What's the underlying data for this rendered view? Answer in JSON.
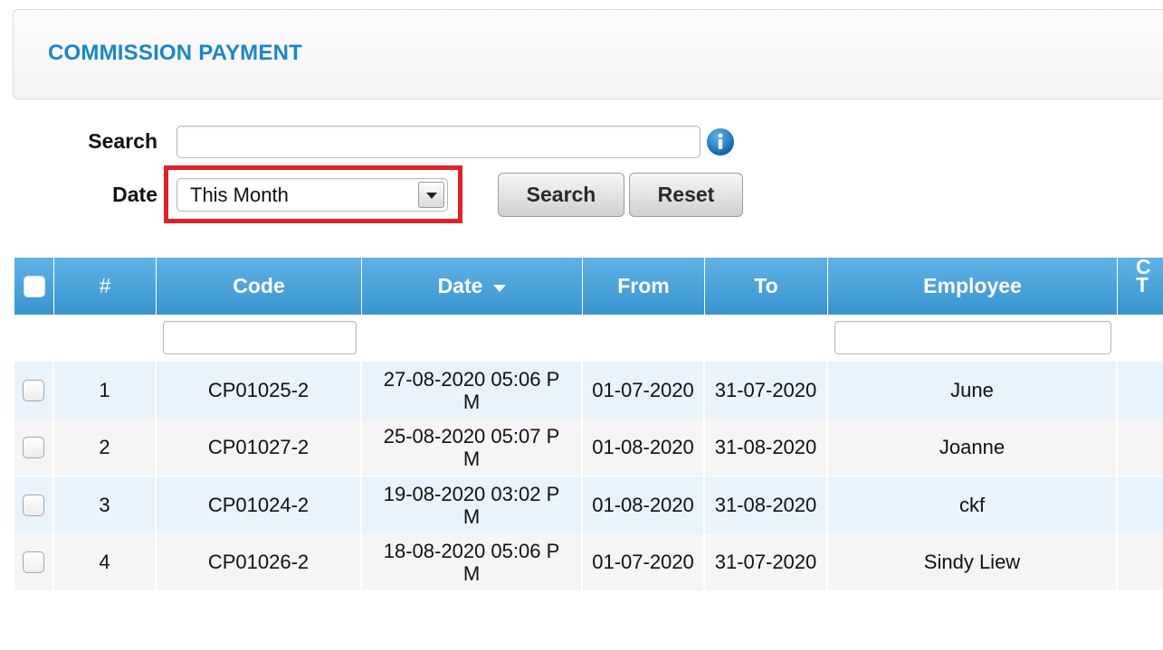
{
  "page": {
    "title": "COMMISSION PAYMENT"
  },
  "filters": {
    "search_label": "Search",
    "search_value": "",
    "search_placeholder": "",
    "date_label": "Date",
    "date_selected": "This Month",
    "search_button": "Search",
    "reset_button": "Reset"
  },
  "table": {
    "columns": {
      "hash": "#",
      "code": "Code",
      "date": "Date",
      "from": "From",
      "to": "To",
      "employee": "Employee",
      "partial_line1": "C",
      "partial_line2": "T"
    },
    "filter_code_value": "",
    "filter_employee_value": "",
    "rows": [
      {
        "num": "1",
        "code": "CP01025-2",
        "date": "27-08-2020 05:06 PM",
        "from": "01-07-2020",
        "to": "31-07-2020",
        "employee": "June"
      },
      {
        "num": "2",
        "code": "CP01027-2",
        "date": "25-08-2020 05:07 PM",
        "from": "01-08-2020",
        "to": "31-08-2020",
        "employee": "Joanne"
      },
      {
        "num": "3",
        "code": "CP01024-2",
        "date": "19-08-2020 03:02 PM",
        "from": "01-08-2020",
        "to": "31-08-2020",
        "employee": "ckf"
      },
      {
        "num": "4",
        "code": "CP01026-2",
        "date": "18-08-2020 05:06 PM",
        "from": "01-07-2020",
        "to": "31-07-2020",
        "employee": "Sindy Liew"
      }
    ]
  },
  "colors": {
    "accent": "#1a86c8",
    "header_bg": "#3894d0",
    "highlight": "#e3202a",
    "row_alt": "#e8f3fb"
  }
}
